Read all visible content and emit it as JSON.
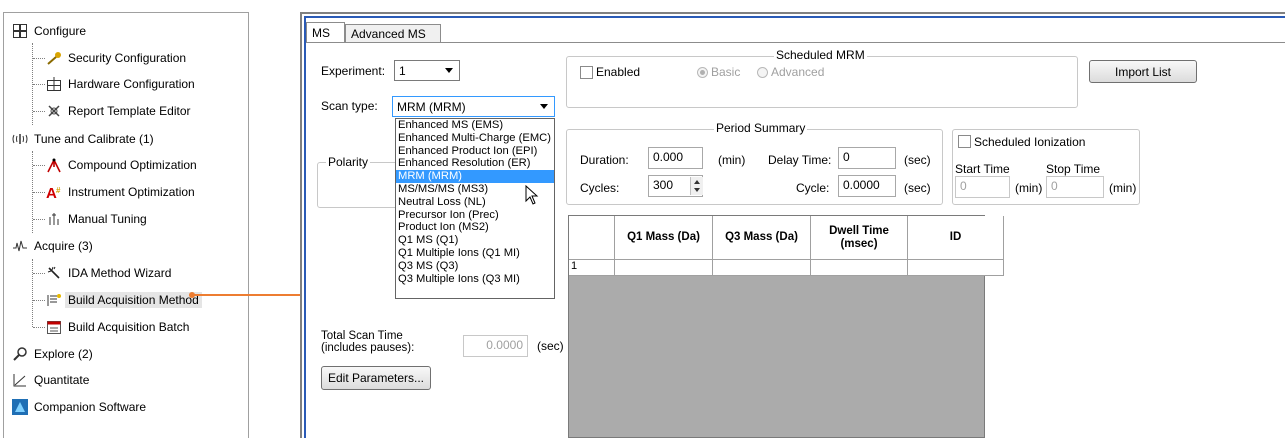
{
  "nav": {
    "items": [
      {
        "label": "Configure"
      },
      {
        "label": "Security Configuration"
      },
      {
        "label": "Hardware Configuration"
      },
      {
        "label": "Report Template Editor"
      },
      {
        "label": "Tune and Calibrate  (1)"
      },
      {
        "label": "Compound Optimization"
      },
      {
        "label": "Instrument Optimization"
      },
      {
        "label": "Manual Tuning"
      },
      {
        "label": "Acquire  (3)"
      },
      {
        "label": "IDA Method Wizard"
      },
      {
        "label": "Build Acquisition Method"
      },
      {
        "label": "Build Acquisition Batch"
      },
      {
        "label": "Explore  (2)"
      },
      {
        "label": "Quantitate"
      },
      {
        "label": "Companion Software"
      }
    ]
  },
  "tabs": [
    {
      "label": "MS"
    },
    {
      "label": "Advanced MS"
    }
  ],
  "form": {
    "experiment_label": "Experiment:",
    "experiment_value": "1",
    "scan_type_label": "Scan type:",
    "scan_type_value": "MRM (MRM)",
    "polarity_label": "Polarity",
    "total_scan_time_label_1": "Total Scan Time",
    "total_scan_time_label_2": "(includes pauses):",
    "total_scan_time_value": "0.0000",
    "total_scan_time_unit": "(sec)",
    "edit_parameters": "Edit Parameters..."
  },
  "scan_type_options": [
    "Enhanced MS (EMS)",
    "Enhanced Multi-Charge (EMC)",
    "Enhanced Product Ion (EPI)",
    "Enhanced Resolution (ER)",
    "MRM (MRM)",
    "MS/MS/MS (MS3)",
    "Neutral Loss (NL)",
    "Precursor Ion (Prec)",
    "Product Ion (MS2)",
    "Q1 MS (Q1)",
    "Q1 Multiple Ions (Q1 MI)",
    "Q3 MS (Q3)",
    "Q3 Multiple Ions (Q3 MI)"
  ],
  "scheduled_mrm": {
    "title": "Scheduled MRM",
    "enabled_label": "Enabled",
    "basic_label": "Basic",
    "advanced_label": "Advanced",
    "import_list": "Import List"
  },
  "period_summary": {
    "title": "Period Summary",
    "duration_label": "Duration:",
    "duration_value": "0.000",
    "duration_unit": "(min)",
    "delay_label": "Delay Time:",
    "delay_value": "0",
    "delay_unit": "(sec)",
    "cycles_label": "Cycles:",
    "cycles_value": "300",
    "cycle_label": "Cycle:",
    "cycle_value": "0.0000",
    "cycle_unit": "(sec)"
  },
  "scheduled_ionization": {
    "label": "Scheduled Ionization",
    "start_time_label": "Start Time",
    "stop_time_label": "Stop Time",
    "start_value": "0",
    "start_unit": "(min)",
    "stop_value": "0",
    "stop_unit": "(min)"
  },
  "grid": {
    "columns": [
      "",
      "Q1 Mass (Da)",
      "Q3 Mass (Da)",
      "Dwell Time (msec)",
      "ID"
    ],
    "rows": [
      [
        "1",
        "",
        "",
        "",
        ""
      ]
    ]
  },
  "colors": {
    "accent": "#2a5ab6",
    "selection": "#3399ff",
    "arrow": "#ed7d31"
  }
}
